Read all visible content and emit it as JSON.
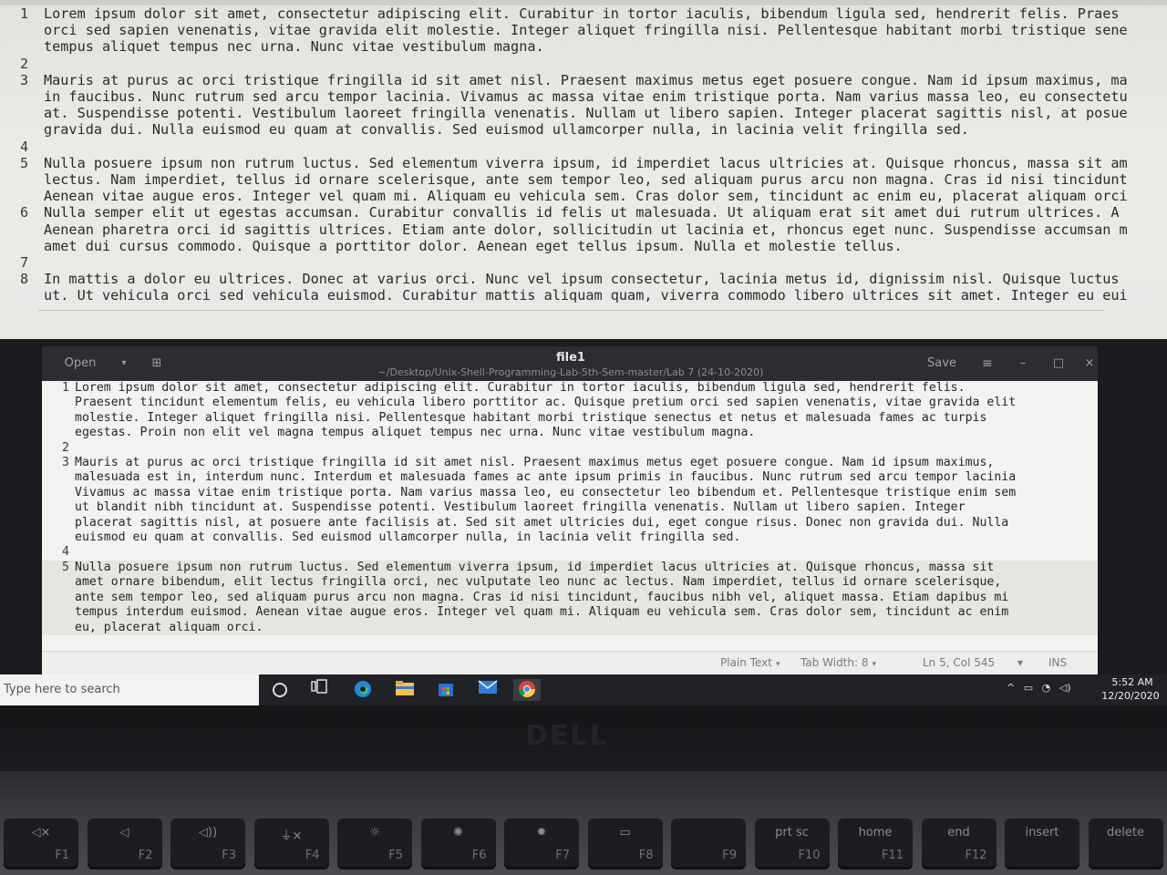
{
  "background_editor": {
    "lines": [
      {
        "n": "1",
        "text": "Lorem ipsum dolor sit amet, consectetur adipiscing elit. Curabitur in tortor iaculis, bibendum ligula sed, hendrerit felis. Praes"
      },
      {
        "n": "",
        "text": "orci sed sapien venenatis, vitae gravida elit molestie. Integer aliquet fringilla nisi. Pellentesque habitant morbi tristique sene"
      },
      {
        "n": "",
        "text": "tempus aliquet tempus nec urna. Nunc vitae vestibulum magna."
      },
      {
        "n": "2",
        "text": ""
      },
      {
        "n": "3",
        "text": "Mauris at purus ac orci tristique fringilla id sit amet nisl. Praesent maximus metus eget posuere congue. Nam id ipsum maximus, ma"
      },
      {
        "n": "",
        "text": "in faucibus. Nunc rutrum sed arcu tempor lacinia. Vivamus ac massa vitae enim tristique porta. Nam varius massa leo, eu consectetu"
      },
      {
        "n": "",
        "text": "at. Suspendisse potenti. Vestibulum laoreet fringilla venenatis. Nullam ut libero sapien. Integer placerat sagittis nisl, at posue"
      },
      {
        "n": "",
        "text": "gravida dui. Nulla euismod eu quam at convallis. Sed euismod ullamcorper nulla, in lacinia velit fringilla sed."
      },
      {
        "n": "4",
        "text": ""
      },
      {
        "n": "5",
        "text": "Nulla posuere ipsum non rutrum luctus. Sed elementum viverra ipsum, id imperdiet lacus ultricies at. Quisque rhoncus, massa sit am"
      },
      {
        "n": "",
        "text": "lectus. Nam imperdiet, tellus id ornare scelerisque, ante sem tempor leo, sed aliquam purus arcu non magna. Cras id nisi tincidunt"
      },
      {
        "n": "",
        "text": "Aenean vitae augue eros. Integer vel quam mi. Aliquam eu vehicula sem. Cras dolor sem, tincidunt ac enim eu, placerat aliquam orci"
      },
      {
        "n": "6",
        "text": "Nulla semper elit ut egestas accumsan. Curabitur convallis id felis ut malesuada. Ut aliquam erat sit amet dui rutrum ultrices. A"
      },
      {
        "n": "",
        "text": "Aenean pharetra orci id sagittis ultrices. Etiam ante dolor, sollicitudin ut lacinia et, rhoncus eget nunc. Suspendisse accumsan m"
      },
      {
        "n": "",
        "text": "amet dui cursus commodo. Quisque a porttitor dolor. Aenean eget tellus ipsum. Nulla et molestie tellus."
      },
      {
        "n": "7",
        "text": ""
      },
      {
        "n": "8",
        "text": "In mattis a dolor eu ultrices. Donec at varius orci. Nunc vel ipsum consectetur, lacinia metus id, dignissim nisl. Quisque luctus"
      },
      {
        "n": "",
        "text": "ut. Ut vehicula orci sed vehicula euismod. Curabitur mattis aliquam quam, viverra commodo libero ultrices sit amet. Integer eu eui"
      }
    ]
  },
  "window": {
    "open_label": "Open",
    "open_menu_glyph": "▾",
    "new_tab_glyph": "⊞",
    "title": "file1",
    "path": "~/Desktop/Unix-Shell-Programming-Lab-5th-Sem-master/Lab 7 (24-10-2020)",
    "save_label": "Save",
    "menu_glyph": "≡",
    "minimize_glyph": "–",
    "maximize_glyph": "□",
    "close_glyph": "×",
    "lines": [
      {
        "n": "1",
        "text": "Lorem ipsum dolor sit amet, consectetur adipiscing elit. Curabitur in tortor iaculis, bibendum ligula sed, hendrerit felis."
      },
      {
        "n": "",
        "text": "Praesent tincidunt elementum felis, eu vehicula libero porttitor ac. Quisque pretium orci sed sapien venenatis, vitae gravida elit"
      },
      {
        "n": "",
        "text": "molestie. Integer aliquet fringilla nisi. Pellentesque habitant morbi tristique senectus et netus et malesuada fames ac turpis"
      },
      {
        "n": "",
        "text": "egestas. Proin non elit vel magna tempus aliquet tempus nec urna. Nunc vitae vestibulum magna."
      },
      {
        "n": "2",
        "text": ""
      },
      {
        "n": "3",
        "text": "Mauris at purus ac orci tristique fringilla id sit amet nisl. Praesent maximus metus eget posuere congue. Nam id ipsum maximus,"
      },
      {
        "n": "",
        "text": "malesuada est in, interdum nunc. Interdum et malesuada fames ac ante ipsum primis in faucibus. Nunc rutrum sed arcu tempor lacinia"
      },
      {
        "n": "",
        "text": "Vivamus ac massa vitae enim tristique porta. Nam varius massa leo, eu consectetur leo bibendum et. Pellentesque tristique enim sem"
      },
      {
        "n": "",
        "text": "ut blandit nibh tincidunt at. Suspendisse potenti. Vestibulum laoreet fringilla venenatis. Nullam ut libero sapien. Integer"
      },
      {
        "n": "",
        "text": "placerat sagittis nisl, at posuere ante facilisis at. Sed sit amet ultricies dui, eget congue risus. Donec non gravida dui. Nulla"
      },
      {
        "n": "",
        "text": "euismod eu quam at convallis. Sed euismod ullamcorper nulla, in lacinia velit fringilla sed."
      },
      {
        "n": "4",
        "text": ""
      },
      {
        "n": "5",
        "text": "Nulla posuere ipsum non rutrum luctus. Sed elementum viverra ipsum, id imperdiet lacus ultricies at. Quisque rhoncus, massa sit"
      },
      {
        "n": "",
        "text": "amet ornare bibendum, elit lectus fringilla orci, nec vulputate leo nunc ac lectus. Nam imperdiet, tellus id ornare scelerisque,"
      },
      {
        "n": "",
        "text": "ante sem tempor leo, sed aliquam purus arcu non magna. Cras id nisi tincidunt, faucibus nibh vel, aliquet massa. Etiam dapibus mi"
      },
      {
        "n": "",
        "text": "tempus interdum euismod. Aenean vitae augue eros. Integer vel quam mi. Aliquam eu vehicula sem. Cras dolor sem, tincidunt ac enim"
      },
      {
        "n": "",
        "text": "eu, placerat aliquam orci."
      }
    ],
    "current_line_number": "5"
  },
  "statusbar": {
    "language": "Plain Text",
    "tab_width": "Tab Width: 8",
    "position": "Ln 5, Col 545",
    "mode": "INS",
    "caret_glyph": "▾"
  },
  "taskbar": {
    "search_placeholder": "Type here to search",
    "icons": [
      "cortana-icon",
      "task-view-icon",
      "edge-icon",
      "file-explorer-icon",
      "store-icon",
      "mail-icon",
      "chrome-icon"
    ],
    "tray_glyphs": {
      "chevron": "^",
      "battery": "▭",
      "network": "◔",
      "volume": "◁)"
    },
    "time": "5:52 AM",
    "date": "12/20/2020"
  },
  "keyboard": {
    "keys": [
      {
        "main": "◁×",
        "sub": "F1"
      },
      {
        "main": "◁",
        "sub": "F2"
      },
      {
        "main": "◁))",
        "sub": "F3"
      },
      {
        "main": "⏚×",
        "sub": "F4"
      },
      {
        "main": "☼",
        "sub": "F5"
      },
      {
        "main": "✺",
        "sub": "F6"
      },
      {
        "main": "✹",
        "sub": "F7"
      },
      {
        "main": "▭",
        "sub": "F8"
      },
      {
        "main": "",
        "sub": "F9"
      },
      {
        "main": "prt sc",
        "sub": "F10"
      },
      {
        "main": "home",
        "sub": "F11"
      },
      {
        "main": "end",
        "sub": "F12"
      },
      {
        "main": "insert",
        "sub": ""
      },
      {
        "main": "delete",
        "sub": ""
      }
    ]
  }
}
